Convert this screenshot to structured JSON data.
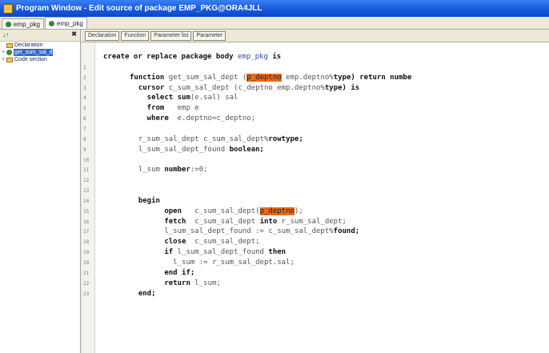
{
  "window": {
    "title": "Program Window - Edit source of package EMP_PKG@ORA4JLL"
  },
  "tabs": [
    {
      "label": "emp_pkg"
    },
    {
      "label": "emp_pkg"
    }
  ],
  "left_pane": {
    "sort_icon": "sort-icon",
    "close_icon": "close-icon",
    "tree": [
      {
        "label": "Declaration",
        "kind": "folder",
        "expander": ""
      },
      {
        "label": "get_sum_sal_d",
        "kind": "function",
        "expander": "+"
      },
      {
        "label": "Code section",
        "kind": "folder",
        "expander": "+"
      }
    ]
  },
  "editor": {
    "subtabs": [
      "Declaration",
      "Function",
      "Parameter list",
      "Parameter"
    ],
    "line_numbers": [
      "1",
      "2",
      "3",
      "4",
      "5",
      "6",
      "7",
      "8",
      "9",
      "10",
      "11",
      "12",
      "13",
      "14",
      "15",
      "16",
      "17",
      "18",
      "19",
      "20",
      "21",
      "22",
      "23"
    ],
    "lines": [
      [
        {
          "t": "create or replace package body ",
          "k": "kw"
        },
        {
          "t": "emp_pkg",
          "k": "id"
        },
        {
          "t": " is",
          "k": "kw"
        }
      ],
      [
        {
          "t": " ",
          "k": "n"
        }
      ],
      [
        {
          "t": "function ",
          "k": "kw"
        },
        {
          "t": "get_sum_sal_dept (",
          "k": "n"
        },
        {
          "t": "p_deptno",
          "k": "hl"
        },
        {
          "t": " emp.deptno%",
          "k": "n"
        },
        {
          "t": "type) return numbe",
          "k": "kw"
        }
      ],
      [
        {
          "t": "  cursor ",
          "k": "kw"
        },
        {
          "t": "c_sum_sal_dept (c_deptno emp.deptno%",
          "k": "n"
        },
        {
          "t": "type) is",
          "k": "kw"
        }
      ],
      [
        {
          "t": "    select ",
          "k": "kw"
        },
        {
          "t": "sum",
          "k": "kw"
        },
        {
          "t": "(e.sal) sal",
          "k": "n"
        }
      ],
      [
        {
          "t": "    from   ",
          "k": "kw"
        },
        {
          "t": "emp e",
          "k": "n"
        }
      ],
      [
        {
          "t": "    where  ",
          "k": "kw"
        },
        {
          "t": "e.deptno=c_deptno;",
          "k": "n"
        }
      ],
      [
        {
          "t": " ",
          "k": "n"
        }
      ],
      [
        {
          "t": "  r_sum_sal_dept c_sum_sal_dept%",
          "k": "n"
        },
        {
          "t": "rowtype;",
          "k": "kw"
        }
      ],
      [
        {
          "t": "  l_sum_sal_dept_found ",
          "k": "n"
        },
        {
          "t": "boolean;",
          "k": "kw"
        }
      ],
      [
        {
          "t": " ",
          "k": "n"
        }
      ],
      [
        {
          "t": "  l_sum ",
          "k": "n"
        },
        {
          "t": "number",
          "k": "kw"
        },
        {
          "t": ":=0;",
          "k": "n"
        }
      ],
      [
        {
          "t": " ",
          "k": "n"
        }
      ],
      [
        {
          "t": " ",
          "k": "n"
        }
      ],
      [
        {
          "t": "  begin",
          "k": "kw"
        }
      ],
      [
        {
          "t": "        open   ",
          "k": "kw"
        },
        {
          "t": "c_sum_sal_dept(",
          "k": "n"
        },
        {
          "t": "p_deptno",
          "k": "hl"
        },
        {
          "t": ");",
          "k": "n"
        }
      ],
      [
        {
          "t": "        fetch  ",
          "k": "kw"
        },
        {
          "t": "c_sum_sal_dept ",
          "k": "n"
        },
        {
          "t": "into ",
          "k": "kw"
        },
        {
          "t": "r_sum_sal_dept;",
          "k": "n"
        }
      ],
      [
        {
          "t": "        l_sum_sal_dept_found := c_sum_sal_dept%",
          "k": "n"
        },
        {
          "t": "found;",
          "k": "kw"
        }
      ],
      [
        {
          "t": "        close  ",
          "k": "kw"
        },
        {
          "t": "c_sum_sal_dept;",
          "k": "n"
        }
      ],
      [
        {
          "t": "        if ",
          "k": "kw"
        },
        {
          "t": "l_sum_sal_dept_found ",
          "k": "n"
        },
        {
          "t": "then",
          "k": "kw"
        }
      ],
      [
        {
          "t": "          l_sum := r_sum_sal_dept.sal;",
          "k": "n"
        }
      ],
      [
        {
          "t": "        end if;",
          "k": "kw"
        }
      ],
      [
        {
          "t": "        return ",
          "k": "kw"
        },
        {
          "t": "l_sum;",
          "k": "n"
        }
      ],
      [
        {
          "t": "  end;",
          "k": "kw"
        }
      ]
    ]
  }
}
